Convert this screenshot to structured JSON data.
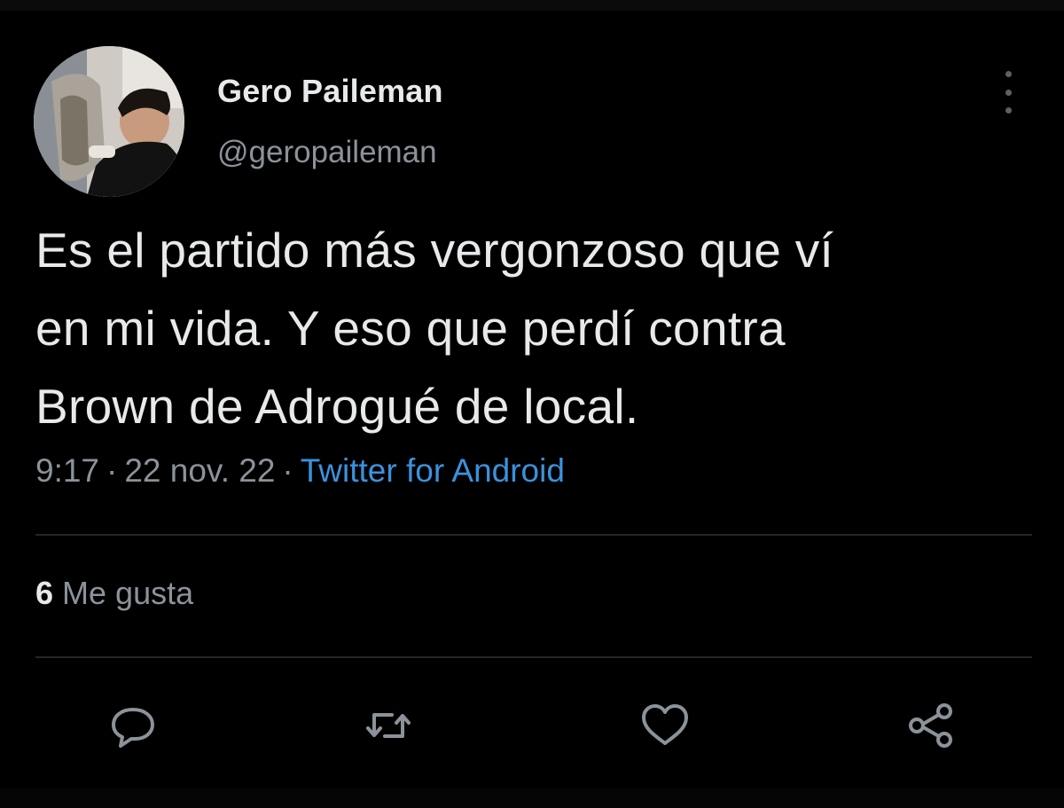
{
  "author": {
    "display_name": "Gero Paileman",
    "handle": "@geropaileman"
  },
  "tweet": {
    "text_lines": [
      "Es el partido más vergonzoso que ví",
      "en mi vida. Y eso que perdí contra",
      "Brown de Adrogué de local."
    ],
    "time": "9:17",
    "date": "22 nov. 22",
    "separator": "·",
    "source": "Twitter for Android"
  },
  "stats": {
    "likes_count": "6",
    "likes_label": "Me gusta"
  },
  "actions": {
    "icons": [
      "reply-icon",
      "retweet-icon",
      "like-icon",
      "share-icon"
    ]
  },
  "colors": {
    "background": "#000000",
    "text": "#e7e9ea",
    "muted": "#8b9299",
    "link": "#3a92dc",
    "divider": "#23272b"
  }
}
